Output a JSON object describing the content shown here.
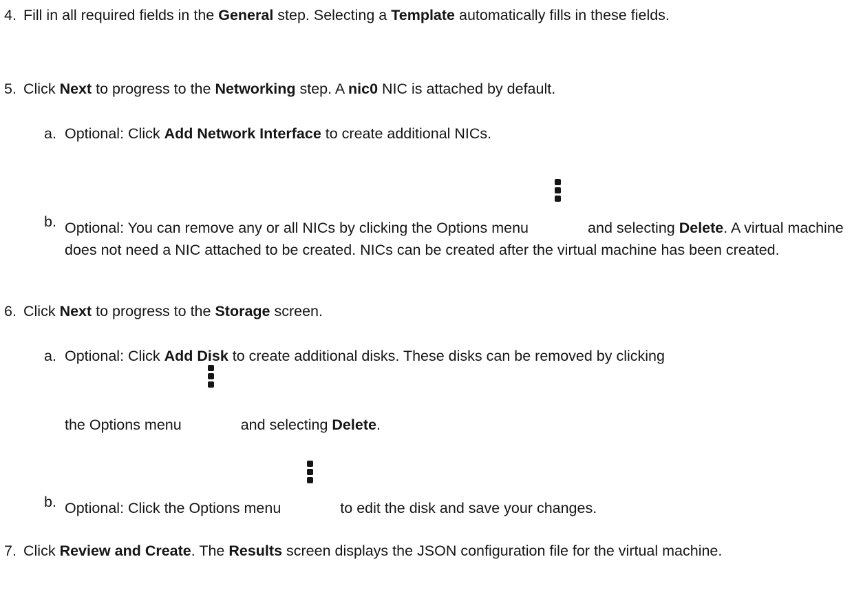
{
  "steps": {
    "s4": {
      "num": "4.",
      "t1": "Fill in all required fields in the ",
      "b1": "General",
      "t2": " step. Selecting a  ",
      "b2": "Template",
      "t3": " automatically fills in these fields."
    },
    "s5": {
      "num": "5.",
      "t1": "Click ",
      "b1": "Next",
      "t2": " to progress to the  ",
      "b2": "Networking",
      "t3": " step. A ",
      "b3": "nic0",
      "t4": " NIC is attached by default."
    },
    "s5a": {
      "num": "a.",
      "t1": "Optional: Click ",
      "b1": "Add Network Interface",
      "t2": " to create additional NICs."
    },
    "s5b": {
      "num": "b.",
      "t1": "Optional: You can remove any or all NICs by clicking the Options menu",
      "t2": "and selecting ",
      "b1": "Delete",
      "t3": ". A virtual machine does not need a NIC attached to be created. NICs can be created after the virtual machine has been created."
    },
    "s6": {
      "num": "6.",
      "t1": "Click ",
      "b1": "Next",
      "t2": " to progress to the  ",
      "b2": "Storage",
      "t3": " screen."
    },
    "s6a": {
      "num": "a.",
      "t1": "Optional: Click ",
      "b1": "Add Disk",
      "t2": " to create additional disks. These disks can be removed by clicking",
      "t3": "the Options menu",
      "t4": "and selecting ",
      "b2": "Delete",
      "t5": "."
    },
    "s6b": {
      "num": "b.",
      "t1": "Optional: Click the Options menu",
      "t2": "to edit the disk and save your changes."
    },
    "s7": {
      "num": "7.",
      "t1": "Click ",
      "b1": "Review and Create",
      "t2": ". The ",
      "b2": "Results",
      "t3": " screen displays the JSON configuration file for the virtual machine."
    }
  },
  "icons": {
    "options_menu": "kebab-vertical-icon"
  }
}
